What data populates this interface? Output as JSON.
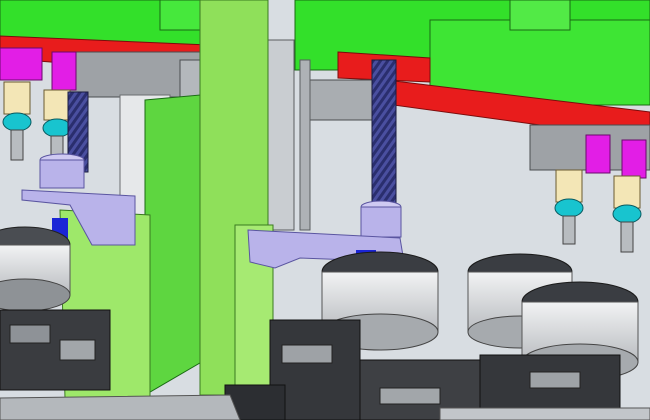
{
  "scene": {
    "kind": "3d-cad-render",
    "colors": {
      "green": "#33e02a",
      "lime": "#8fe05a",
      "red": "#e81c1c",
      "magenta": "#e21ee6",
      "cream": "#f3e6b6",
      "cyan": "#18c4cf",
      "lavender": "#b9b3ea",
      "gray": "#9ea2a6",
      "dark": "#303236",
      "blue": "#1b25d6",
      "leadscrew": "#2a2e6e"
    }
  }
}
